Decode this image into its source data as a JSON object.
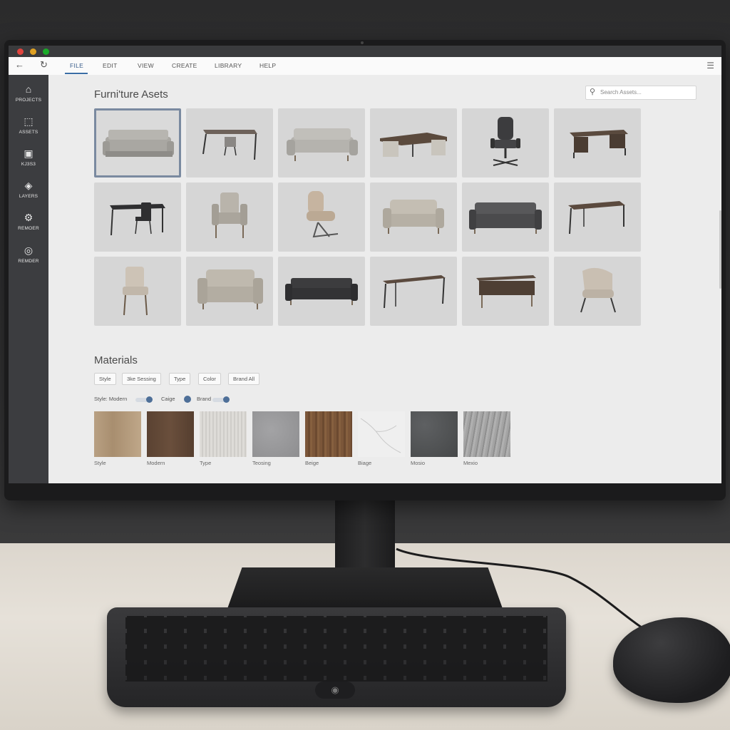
{
  "window": {
    "controls": [
      "close",
      "minimize",
      "maximize"
    ],
    "colors": {
      "close": "#e0443e",
      "minimize": "#dfa123",
      "maximize": "#1aab29",
      "accent": "#3b6ea5",
      "sidebar": "#3c3d40"
    }
  },
  "menubar": {
    "back_icon": "back-arrow-icon",
    "reload_icon": "reload-icon",
    "items": [
      {
        "label": "FILE",
        "active": true
      },
      {
        "label": "EDIT"
      },
      {
        "label": "VIEW"
      },
      {
        "label": "CREATE"
      },
      {
        "label": "LIBRARY"
      },
      {
        "label": "HELP"
      }
    ],
    "menu_icon": "hamburger-icon"
  },
  "sidebar": {
    "items": [
      {
        "label": "PROJECTS",
        "icon": "home-icon"
      },
      {
        "label": "ASSETS",
        "icon": "cube-icon"
      },
      {
        "label": "KJ3S3",
        "icon": "image-icon"
      },
      {
        "label": "LAYERS",
        "icon": "layers-icon"
      },
      {
        "label": "REMOER",
        "icon": "render-icon"
      },
      {
        "label": "REMDER",
        "icon": "globe-icon"
      }
    ]
  },
  "assets": {
    "title": "Furni'ture Asets",
    "search_placeholder": "Search Assets...",
    "items": [
      {
        "name": "sofa",
        "selected": true
      },
      {
        "name": "desk-with-chair"
      },
      {
        "name": "sofa"
      },
      {
        "name": "l-shaped-desk"
      },
      {
        "name": "office-chair"
      },
      {
        "name": "executive-desk"
      },
      {
        "name": "desk-with-chair"
      },
      {
        "name": "armchair"
      },
      {
        "name": "lounge-chair"
      },
      {
        "name": "loveseat"
      },
      {
        "name": "dark-sofa"
      },
      {
        "name": "desk"
      },
      {
        "name": "dining-chair"
      },
      {
        "name": "loveseat"
      },
      {
        "name": "dark-sofa"
      },
      {
        "name": "desk"
      },
      {
        "name": "sideboard-desk"
      },
      {
        "name": "accent-chair"
      }
    ]
  },
  "materials": {
    "title": "Materials",
    "chips": [
      "Style",
      "3ke Sessing",
      "Type",
      "Color",
      "Brand All"
    ],
    "filters": {
      "style_label": "Style: Modern",
      "color_label": "Caige",
      "brand_label": "Brand"
    },
    "swatches": [
      {
        "label": "Style",
        "color": "#b49c7d"
      },
      {
        "label": "Modern",
        "color": "#5e4636"
      },
      {
        "label": "Type",
        "color": "#d9d7d3"
      },
      {
        "label": "Teosing",
        "color": "#9b9b9d"
      },
      {
        "label": "Beige",
        "color": "#7b5639"
      },
      {
        "label": "Biage",
        "color": "#efefef"
      },
      {
        "label": "Mosio",
        "color": "#505254"
      },
      {
        "label": "Mexio",
        "color": "#a0a0a0"
      }
    ]
  }
}
